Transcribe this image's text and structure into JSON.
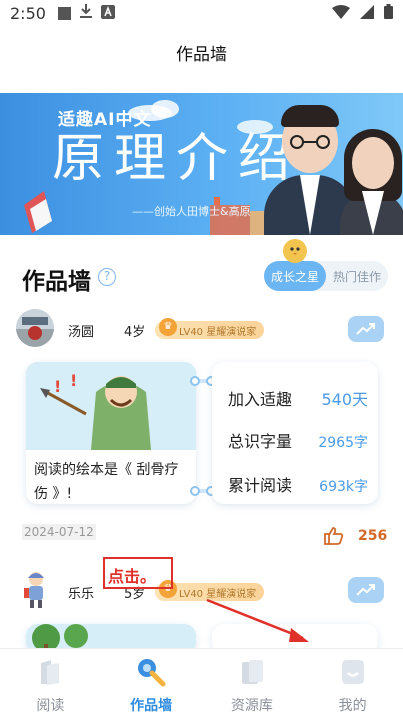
{
  "status_bar": {
    "time": "2:50"
  },
  "header": {
    "title": "作品墙"
  },
  "banner": {
    "brand": "适趣AI中文",
    "title": "原理介绍",
    "subtitle": "——创始人田博士&高原"
  },
  "section": {
    "title": "作品墙",
    "help": "?",
    "tabs": [
      {
        "label": "成长之星",
        "active": true
      },
      {
        "label": "热门佳作",
        "active": false
      }
    ]
  },
  "entries": [
    {
      "name": "汤圆",
      "age": "4岁",
      "badge": "LV40 星耀演说家",
      "caption": "阅读的绘本是《 刮骨疗伤 》!",
      "stats": [
        {
          "label": "加入适趣",
          "value": "540天"
        },
        {
          "label": "总识字量",
          "value": "2965字"
        },
        {
          "label": "累计阅读",
          "value": "693k字"
        }
      ],
      "date": "2024-07-12",
      "likes": "256"
    },
    {
      "name": "乐乐",
      "age": "5岁",
      "badge": "LV40 星耀演说家"
    }
  ],
  "annotation": {
    "text": "点击。"
  },
  "nav": {
    "items": [
      {
        "label": "阅读"
      },
      {
        "label": "作品墙"
      },
      {
        "label": "资源库"
      },
      {
        "label": "我的"
      }
    ]
  },
  "colors": {
    "accent": "#2f8ce0",
    "stat_value": "#4b9be8",
    "badge": "#fbd39a",
    "like": "#d26a2a",
    "annotation": "#e0302a"
  }
}
